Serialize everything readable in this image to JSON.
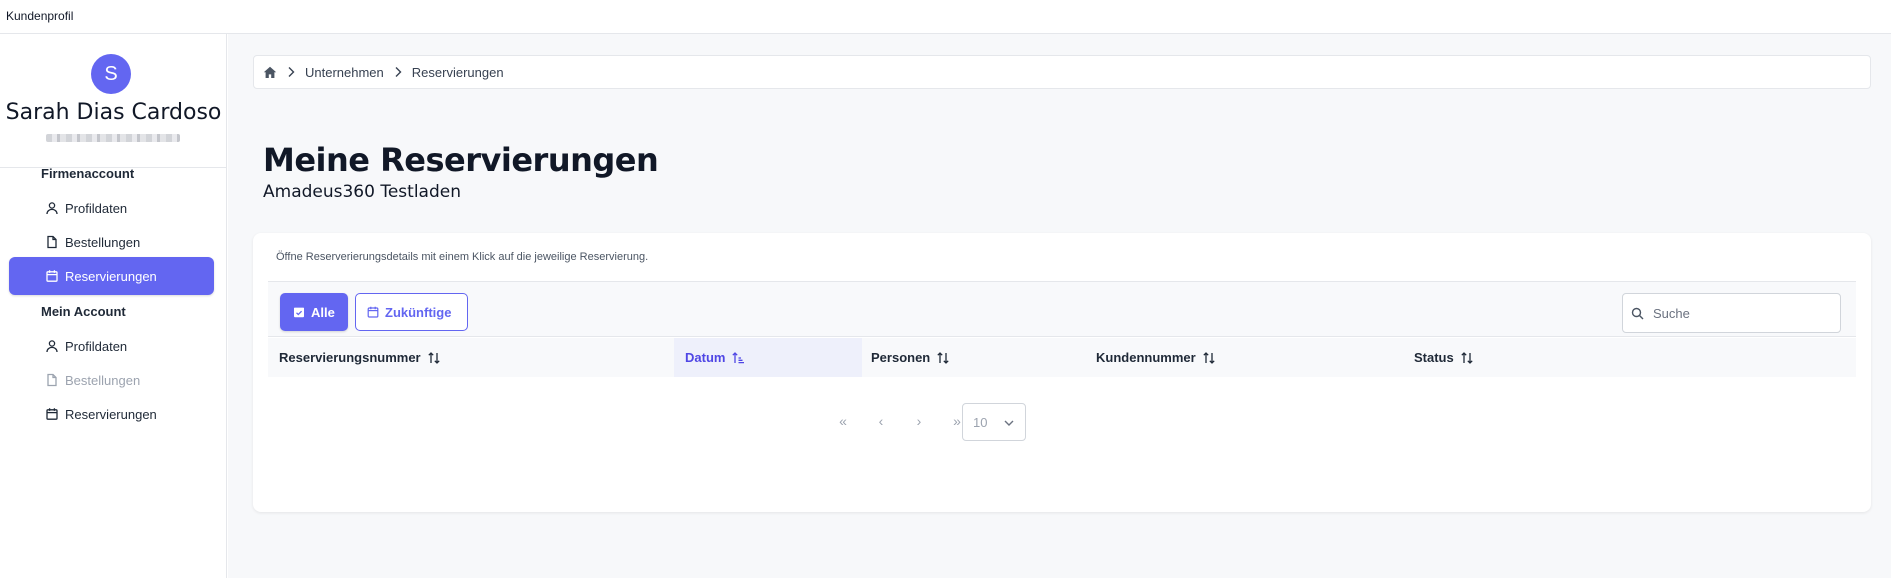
{
  "window": {
    "title": "Kundenprofil"
  },
  "user": {
    "initial": "S",
    "name": "Sarah Dias Cardoso"
  },
  "sidebar": {
    "sections": [
      {
        "label": "Firmenaccount",
        "items": [
          {
            "label": "Profildaten",
            "icon": "user-icon",
            "state": "normal"
          },
          {
            "label": "Bestellungen",
            "icon": "document-icon",
            "state": "normal"
          },
          {
            "label": "Reservierungen",
            "icon": "calendar-icon",
            "state": "active"
          }
        ]
      },
      {
        "label": "Mein Account",
        "items": [
          {
            "label": "Profildaten",
            "icon": "user-icon",
            "state": "normal"
          },
          {
            "label": "Bestellungen",
            "icon": "document-icon",
            "state": "disabled"
          },
          {
            "label": "Reservierungen",
            "icon": "calendar-icon",
            "state": "normal"
          }
        ]
      }
    ]
  },
  "breadcrumb": {
    "home_icon": "home-icon",
    "items": [
      "Unternehmen",
      "Reservierungen"
    ]
  },
  "page": {
    "title": "Meine Reservierungen",
    "subtitle": "Amadeus360 Testladen"
  },
  "card": {
    "hint": "Öffne Reserverierungsdetails mit einem Klick auf die jeweilige Reservierung.",
    "filters": {
      "all_label": "Alle",
      "future_label": "Zukünftige",
      "active": "all"
    },
    "search": {
      "placeholder": "Suche",
      "value": ""
    },
    "columns": [
      {
        "label": "Reservierungsnummer",
        "sorted": false
      },
      {
        "label": "Datum",
        "sorted": true,
        "direction": "asc"
      },
      {
        "label": "Personen",
        "sorted": false
      },
      {
        "label": "Kundennummer",
        "sorted": false
      },
      {
        "label": "Status",
        "sorted": false
      }
    ],
    "rows": [],
    "pagination": {
      "first": "«",
      "prev": "‹",
      "next": "›",
      "last": "»",
      "rows_per_page": "10"
    }
  },
  "colors": {
    "accent": "#6366f1",
    "sorted_header_bg": "#eef0fb",
    "page_bg": "#f7f8fa"
  }
}
